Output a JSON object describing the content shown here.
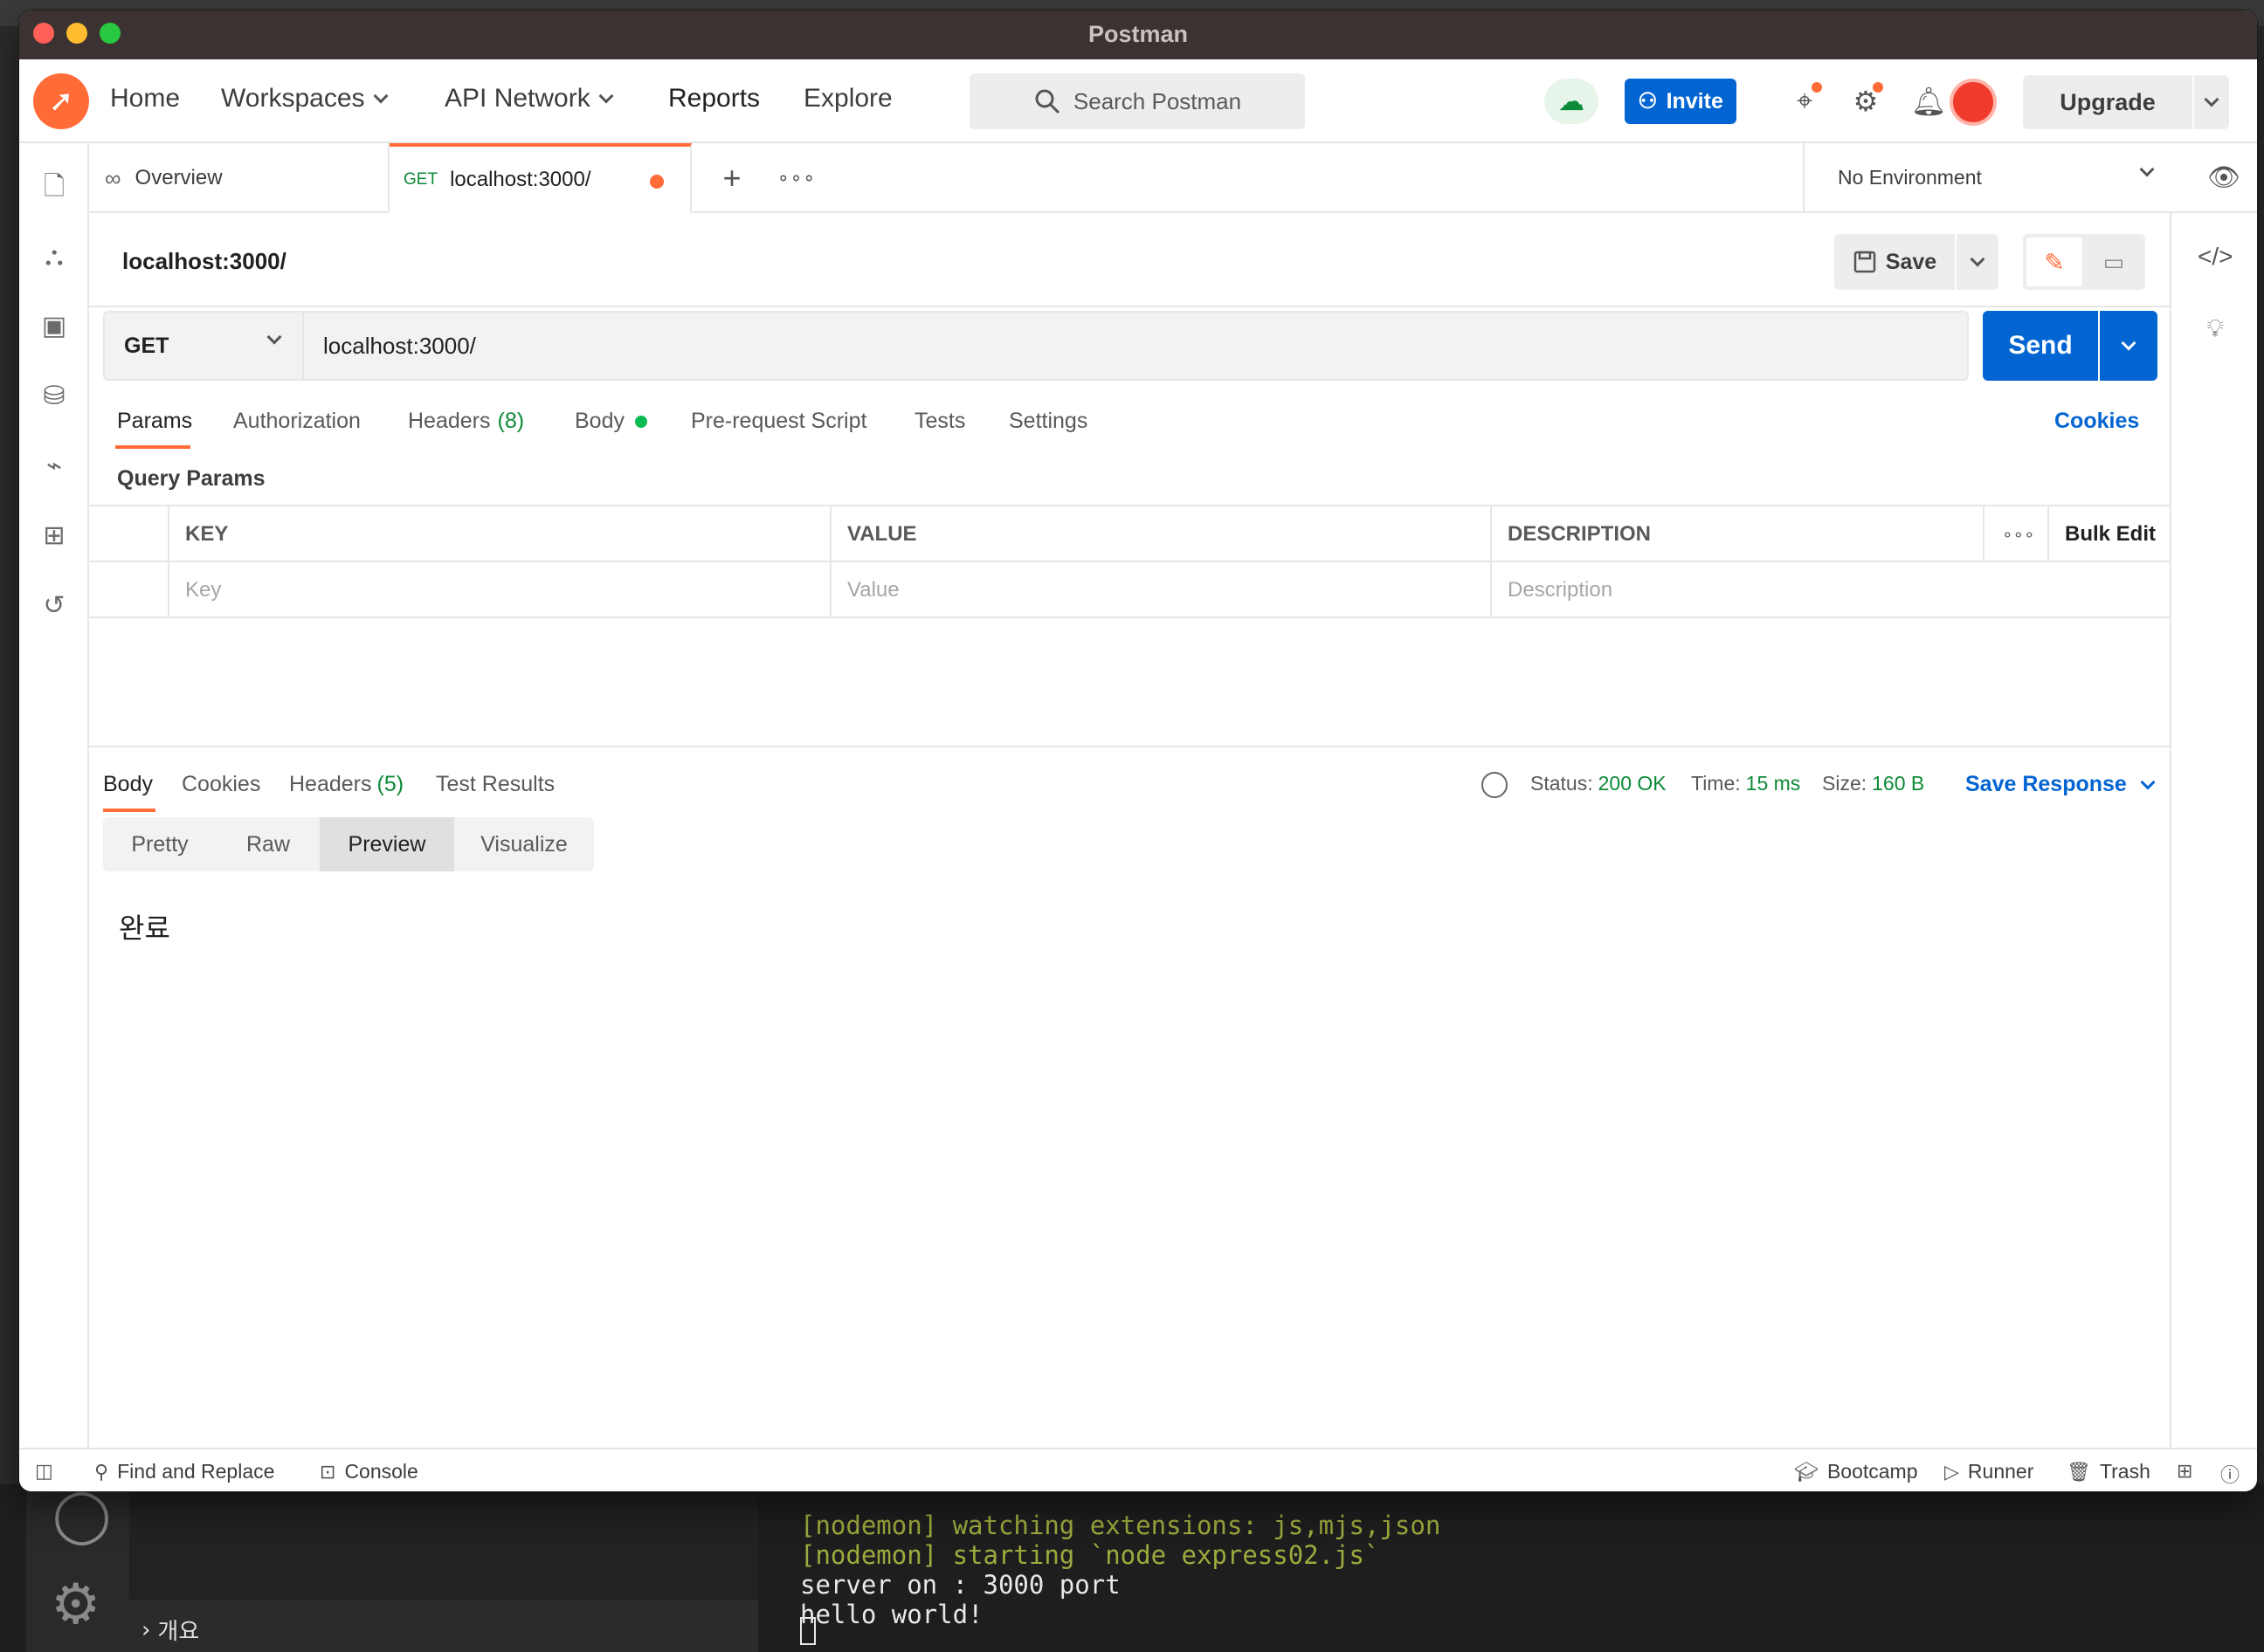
{
  "window": {
    "title": "Postman"
  },
  "nav": {
    "home": "Home",
    "workspaces": "Workspaces",
    "api_network": "API Network",
    "reports": "Reports",
    "explore": "Explore",
    "search_placeholder": "Search Postman",
    "invite": "Invite",
    "upgrade": "Upgrade"
  },
  "tabs": {
    "overview": "Overview",
    "active_method": "GET",
    "active_label": "localhost:3000/"
  },
  "environment": {
    "selected": "No Environment"
  },
  "request": {
    "name": "localhost:3000/",
    "save": "Save",
    "method": "GET",
    "url": "localhost:3000/",
    "send": "Send",
    "tabs": {
      "params": "Params",
      "authorization": "Authorization",
      "headers": "Headers",
      "headers_count": "(8)",
      "body": "Body",
      "prerequest": "Pre-request Script",
      "tests": "Tests",
      "settings": "Settings"
    },
    "cookies": "Cookies",
    "query_params_label": "Query Params",
    "table": {
      "headers": [
        "KEY",
        "VALUE",
        "DESCRIPTION"
      ],
      "bulk_edit": "Bulk Edit",
      "placeholders": [
        "Key",
        "Value",
        "Description"
      ]
    }
  },
  "response": {
    "tabs": {
      "body": "Body",
      "cookies": "Cookies",
      "headers": "Headers",
      "headers_count": "(5)",
      "test_results": "Test Results"
    },
    "status_label": "Status:",
    "status_value": "200 OK",
    "time_label": "Time:",
    "time_value": "15 ms",
    "size_label": "Size:",
    "size_value": "160 B",
    "save_response": "Save Response",
    "views": [
      "Pretty",
      "Raw",
      "Preview",
      "Visualize"
    ],
    "active_view": "Preview",
    "preview_content": "완료"
  },
  "statusbar": {
    "find_replace": "Find and Replace",
    "console": "Console",
    "bootcamp": "Bootcamp",
    "runner": "Runner",
    "trash": "Trash"
  },
  "background": {
    "sidebar_section": "개요",
    "terminal": [
      "[nodemon] watching extensions: js,mjs,json",
      "[nodemon] starting `node express02.js`",
      "server on : 3000 port",
      "hello world!"
    ]
  },
  "colors": {
    "brand": "#ff6c37",
    "primary": "#0265d2",
    "success": "#0c8a36"
  }
}
